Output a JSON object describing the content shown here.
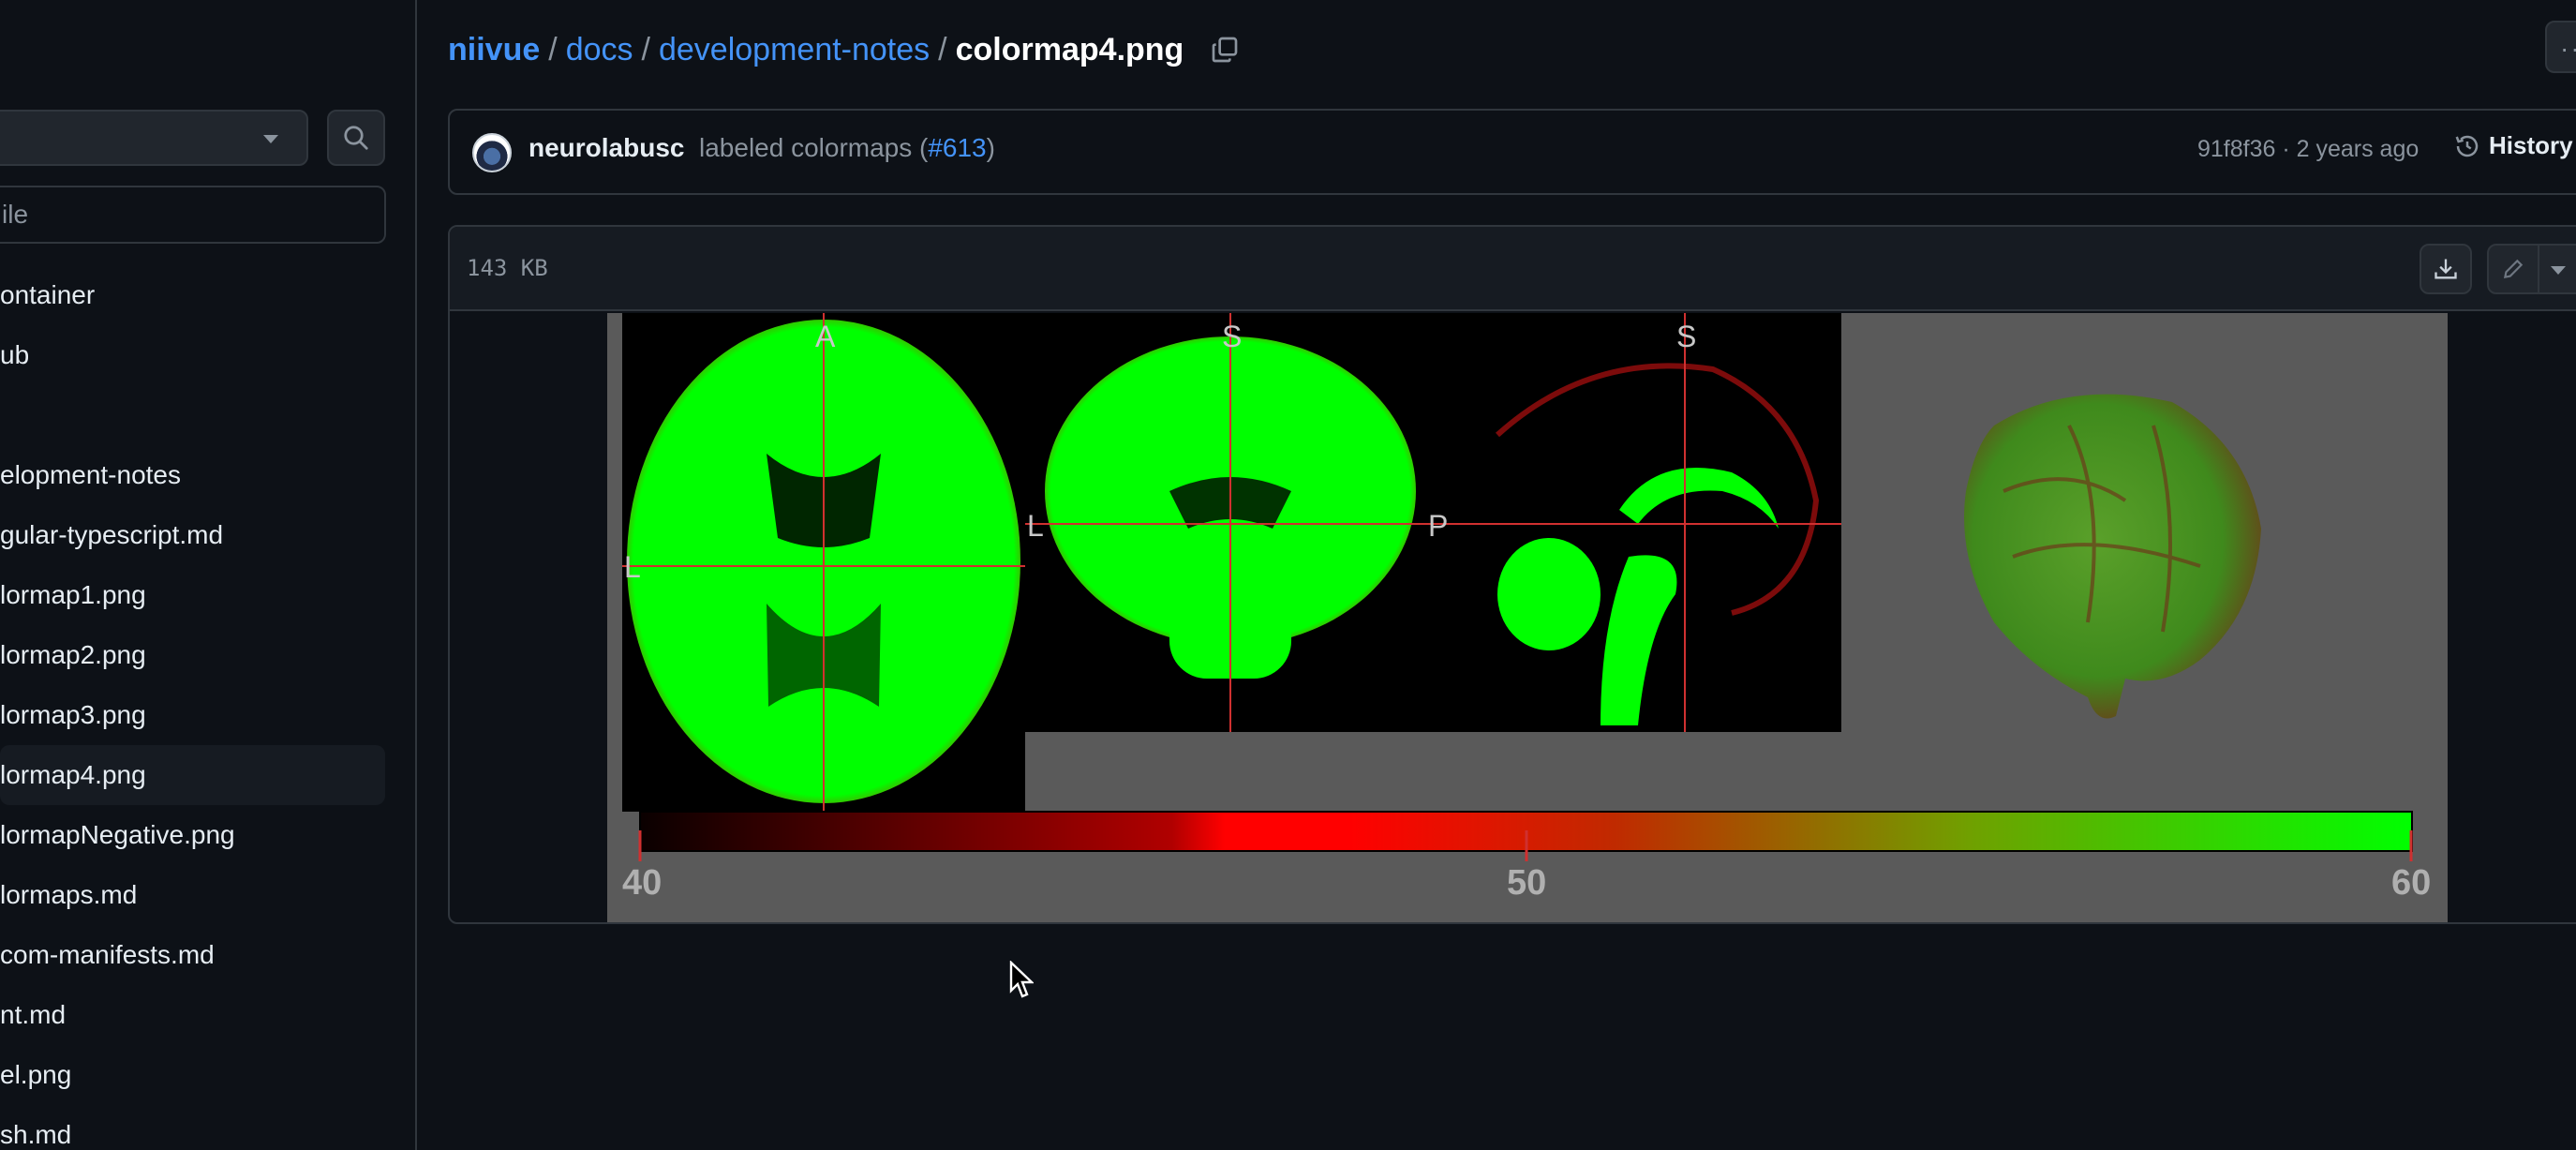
{
  "sidebar": {
    "filter_placeholder": "ile",
    "items": [
      {
        "label": "ontainer"
      },
      {
        "label": "ub"
      },
      {
        "label": ""
      },
      {
        "label": "elopment-notes"
      },
      {
        "label": "gular-typescript.md"
      },
      {
        "label": "lormap1.png"
      },
      {
        "label": "lormap2.png"
      },
      {
        "label": "lormap3.png"
      },
      {
        "label": "lormap4.png",
        "active": true
      },
      {
        "label": "lormapNegative.png"
      },
      {
        "label": "lormaps.md"
      },
      {
        "label": "com-manifests.md"
      },
      {
        "label": "nt.md"
      },
      {
        "label": "el.png"
      },
      {
        "label": "sh.md"
      }
    ]
  },
  "breadcrumb": {
    "repo": "niivue",
    "sep": "/",
    "folder1": "docs",
    "folder2": "development-notes",
    "file": "colormap4.png"
  },
  "commit": {
    "author": "neurolabusc",
    "message_prefix": "labeled colormaps (",
    "pr": "#613",
    "message_suffix": ")",
    "meta": "91f8f36 · 2 years ago",
    "history_label": "History"
  },
  "file": {
    "size": "143 KB"
  },
  "image": {
    "labels": {
      "axial_top": "A",
      "axial_left": "L",
      "coronal_top": "S",
      "coronal_left": "L",
      "sagittal_top": "S",
      "sagittal_left": "P"
    },
    "colorbar_ticks": [
      "40",
      "50",
      "60"
    ]
  },
  "colors": {
    "background": "#0d1117",
    "border": "#30363d",
    "link": "#4493f8",
    "muted": "#8b949e",
    "colormap_low": "#000000",
    "colormap_mid": "#ff0000",
    "colormap_high": "#00ff00"
  },
  "icons": [
    "search-icon",
    "copy-icon",
    "history-icon",
    "download-icon",
    "pencil-icon",
    "chevron-down-icon",
    "kebab-icon"
  ]
}
